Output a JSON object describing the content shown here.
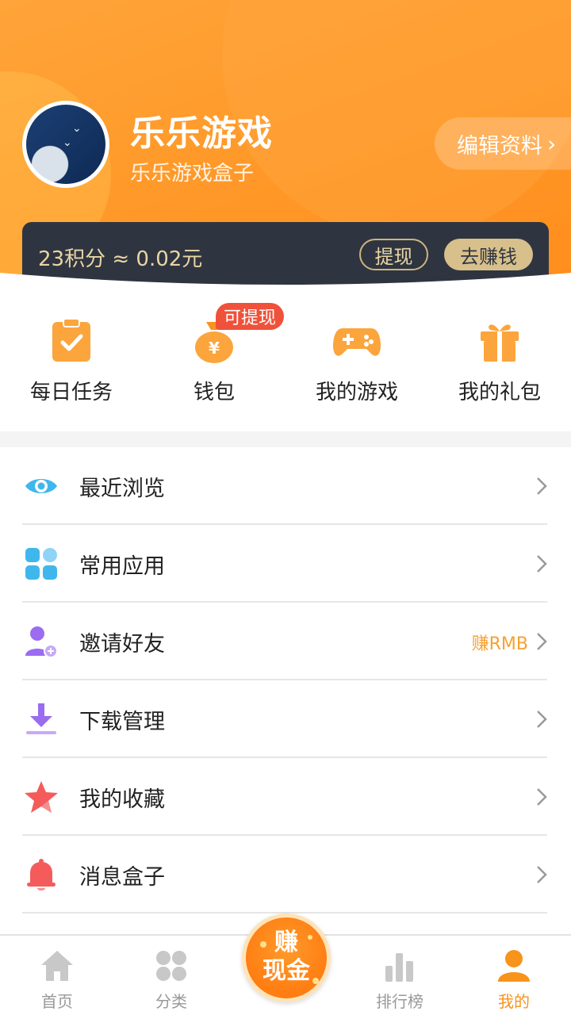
{
  "profile": {
    "name": "乐乐游戏",
    "subtitle": "乐乐游戏盒子",
    "edit_label": "编辑资料",
    "edit_chevron": "›"
  },
  "points": {
    "text": "23积分 ≈ 0.02元",
    "withdraw_label": "提现",
    "earn_label": "去赚钱"
  },
  "quick_actions": {
    "items": [
      {
        "label": "每日任务",
        "icon": "task-icon"
      },
      {
        "label": "钱包",
        "icon": "money-bag-icon"
      },
      {
        "label": "我的游戏",
        "icon": "gamepad-icon"
      },
      {
        "label": "我的礼包",
        "icon": "gift-icon"
      }
    ],
    "badge": "可提现"
  },
  "menu": {
    "items": [
      {
        "label": "最近浏览",
        "icon": "eye-icon"
      },
      {
        "label": "常用应用",
        "icon": "apps-grid-icon"
      },
      {
        "label": "邀请好友",
        "icon": "invite-user-icon",
        "extra": "赚RMB"
      },
      {
        "label": "下载管理",
        "icon": "download-icon"
      },
      {
        "label": "我的收藏",
        "icon": "star-icon"
      },
      {
        "label": "消息盒子",
        "icon": "bell-icon"
      }
    ]
  },
  "tabbar": {
    "items": [
      {
        "label": "首页",
        "icon": "home-icon"
      },
      {
        "label": "分类",
        "icon": "category-icon"
      },
      {
        "label": "排行榜",
        "icon": "ranking-icon"
      },
      {
        "label": "我的",
        "icon": "user-icon",
        "active": true
      }
    ],
    "center_line1": "赚",
    "center_line2": "现金"
  },
  "colors": {
    "header_orange": "#ff9a2a",
    "accent": "#f8931b",
    "points_bar": "#2f3540",
    "gold": "#d8c08c",
    "badge_red": "#f0513a"
  }
}
